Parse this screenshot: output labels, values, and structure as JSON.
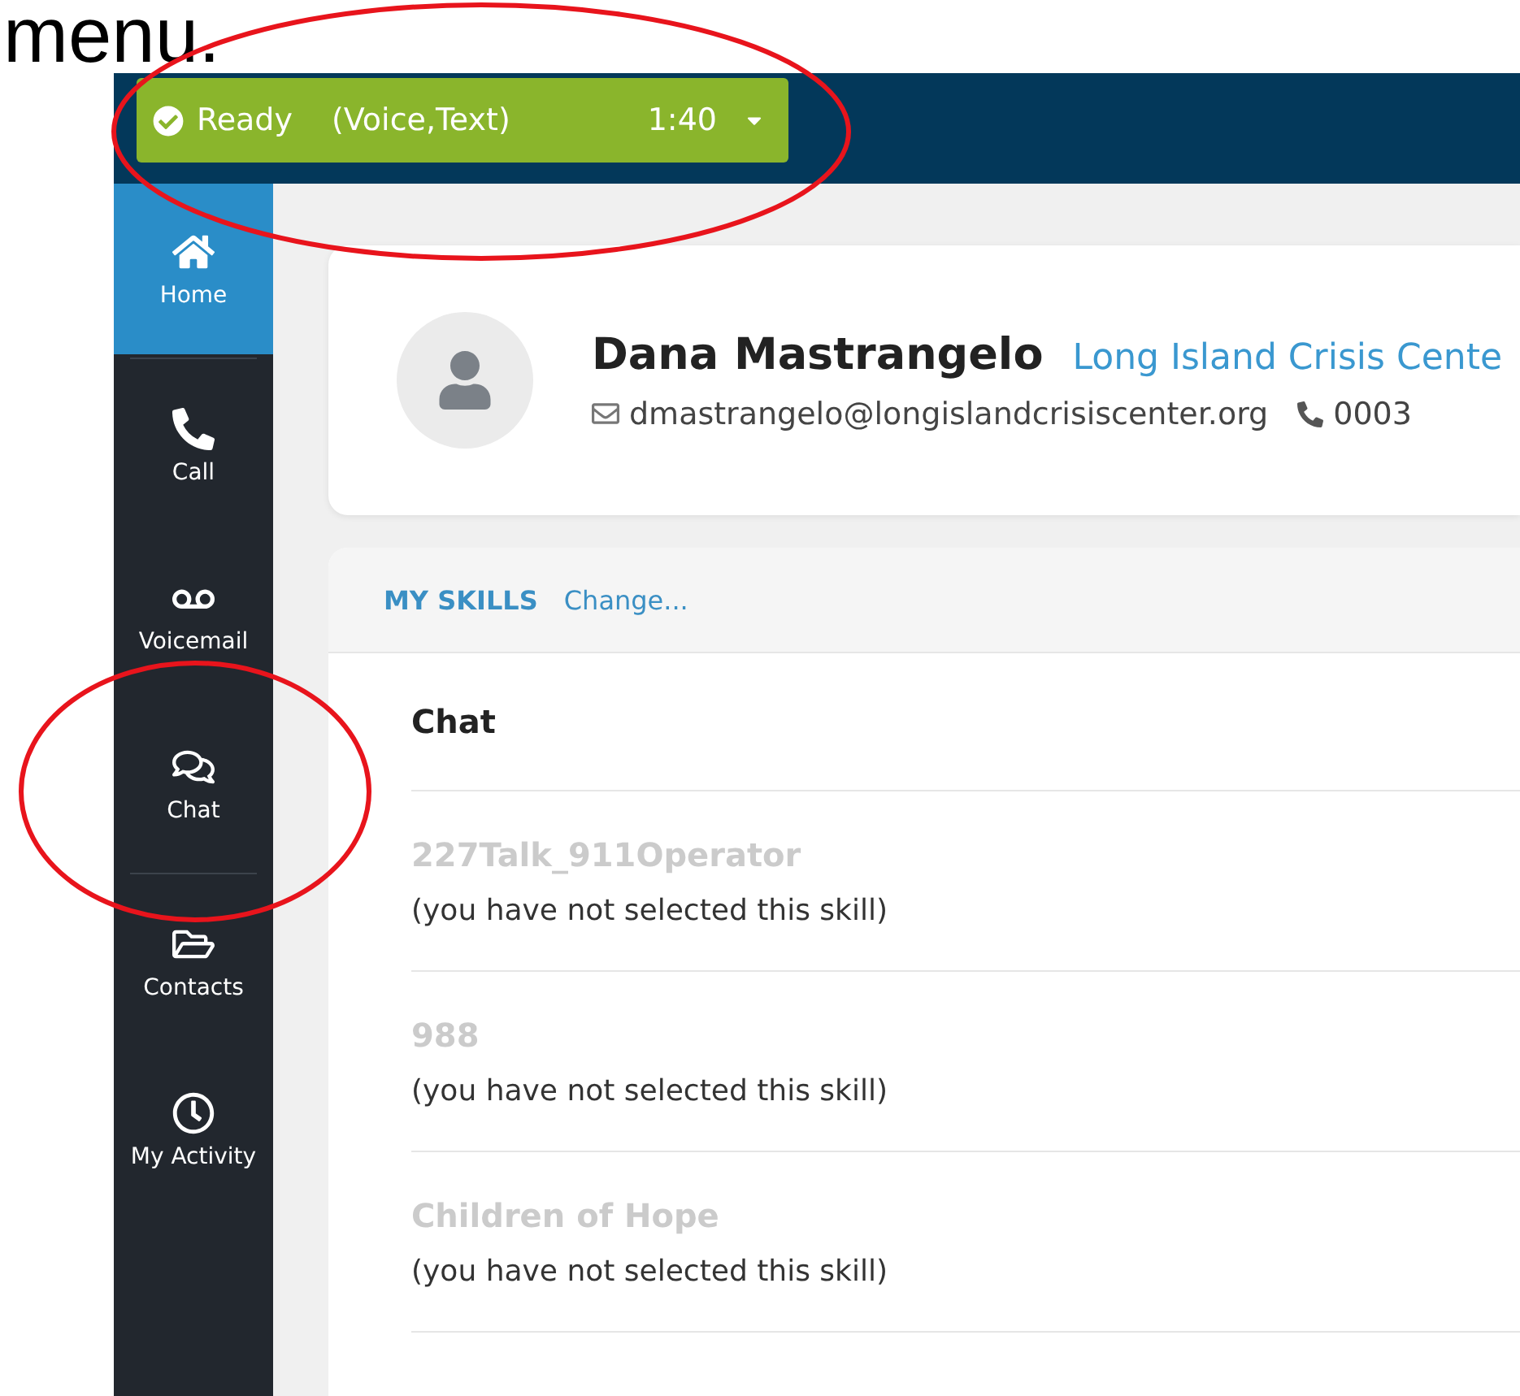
{
  "caption": "menu.",
  "status": {
    "state": "Ready",
    "channels": "(Voice,Text)",
    "timer": "1:40",
    "ready": true
  },
  "sidebar": {
    "items": [
      {
        "label": "Home",
        "kind": "home",
        "selected": true,
        "divider_after": true
      },
      {
        "label": "Call",
        "kind": "phone",
        "selected": false,
        "divider_after": false
      },
      {
        "label": "Voicemail",
        "kind": "voicemail",
        "selected": false,
        "divider_after": false
      },
      {
        "label": "Chat",
        "kind": "chat",
        "selected": false,
        "divider_after": true
      },
      {
        "label": "Contacts",
        "kind": "folder",
        "selected": false,
        "divider_after": false
      },
      {
        "label": "My Activity",
        "kind": "clock",
        "selected": false,
        "divider_after": false
      }
    ]
  },
  "profile": {
    "name": "Dana Mastrangelo",
    "org": "Long Island Crisis Cente",
    "email": "dmastrangelo@longislandcrisiscenter.org",
    "extension": "0003"
  },
  "skills": {
    "title": "MY SKILLS",
    "change_link": "Change...",
    "group": "Chat",
    "items": [
      {
        "name": "227Talk_911Operator",
        "note": "(you have not selected this skill)",
        "selected": false
      },
      {
        "name": "988",
        "note": "(you have not selected this skill)",
        "selected": false
      },
      {
        "name": "Children of Hope",
        "note": "(you have not selected this skill)",
        "selected": false
      }
    ]
  }
}
